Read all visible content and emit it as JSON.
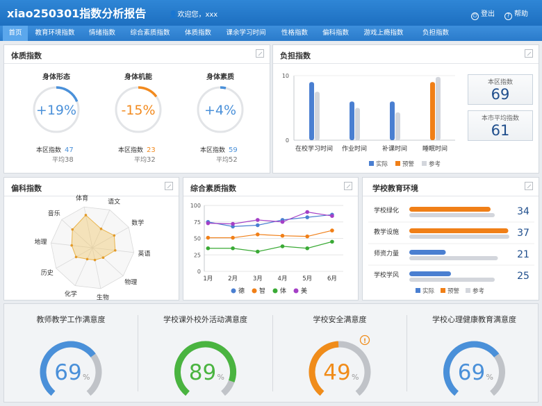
{
  "header": {
    "title": "xiao250301指数分析报告",
    "welcome": "欢迎您，xxx",
    "logout": "登出",
    "help": "帮助"
  },
  "nav": {
    "tabs": [
      "首页",
      "教育环境指数",
      "情绪指数",
      "综合素质指数",
      "体质指数",
      "课余学习时间",
      "性格指数",
      "偏科指数",
      "游戏上瘾指数",
      "负担指数"
    ]
  },
  "physique": {
    "title": "体质指数",
    "region_label": "本区指数",
    "avg_label": "平均",
    "items": [
      {
        "name": "身体形态",
        "value": "+19%",
        "region": "47",
        "avg": "38",
        "fraction": 0.19,
        "color": "#4a90d9"
      },
      {
        "name": "身体机能",
        "value": "-15%",
        "region": "23",
        "avg": "32",
        "fraction": 0.15,
        "color": "#f28a1e"
      },
      {
        "name": "身体素质",
        "value": "+4%",
        "region": "59",
        "avg": "52",
        "fraction": 0.04,
        "color": "#4a90d9"
      }
    ]
  },
  "burden": {
    "title": "负担指数",
    "chart_data": {
      "type": "bar",
      "categories": [
        "在校学习时间",
        "作业时间",
        "补课时间",
        "睡眠时间"
      ],
      "series": [
        {
          "name": "实际",
          "color": "#4a7fd1",
          "values": [
            9,
            6,
            6,
            9
          ]
        },
        {
          "name": "预警",
          "color": "#f07f17",
          "values": [
            0,
            0,
            0,
            0
          ]
        },
        {
          "name": "参考",
          "color": "#d3d6dc",
          "values": [
            7.5,
            5,
            4.3,
            9.8
          ]
        }
      ],
      "ylim": [
        0,
        10
      ],
      "yticks": [
        "0",
        "10"
      ]
    },
    "region_label": "本区指数",
    "region_value": "69",
    "city_label": "本市平均指数",
    "city_value": "61"
  },
  "partial": {
    "title": "偏科指数",
    "chart_data": {
      "type": "radar",
      "axes": [
        "体育",
        "语文",
        "数学",
        "英语",
        "物理",
        "生物",
        "化学",
        "历史",
        "地理",
        "音乐"
      ],
      "values": [
        0.8,
        0.5,
        0.6,
        0.55,
        0.35,
        0.3,
        0.3,
        0.45,
        0.5,
        0.65
      ],
      "max": 1
    }
  },
  "comprehensive": {
    "title": "综合素质指数",
    "chart_data": {
      "type": "line",
      "categories": [
        "1月",
        "2月",
        "3月",
        "4月",
        "5月",
        "6月"
      ],
      "ylim": [
        0,
        100
      ],
      "yticks": [
        "0",
        "25",
        "50",
        "75",
        "100"
      ],
      "series": [
        {
          "name": "德",
          "color": "#4a7fd1",
          "values": [
            75,
            68,
            70,
            78,
            82,
            86
          ]
        },
        {
          "name": "智",
          "color": "#f07f17",
          "values": [
            51,
            51,
            56,
            54,
            53,
            62
          ]
        },
        {
          "name": "体",
          "color": "#3aaa35",
          "values": [
            35,
            35,
            30,
            38,
            35,
            45
          ]
        },
        {
          "name": "美",
          "color": "#a43fc6",
          "values": [
            73,
            72,
            78,
            75,
            90,
            84
          ]
        }
      ]
    }
  },
  "school_env": {
    "title": "学校教育环境",
    "chart_data": {
      "type": "bar",
      "categories": [
        "学校绿化",
        "教学设施",
        "师资力量",
        "学校学风"
      ],
      "values": [
        "34",
        "37",
        "21",
        "25"
      ],
      "series": [
        {
          "name": "实际",
          "color": "#4a7fd1",
          "values": [
            0.55,
            0.6,
            0.35,
            0.4
          ]
        },
        {
          "name": "预警",
          "color": "#f07f17",
          "values": [
            0.78,
            0.95,
            0,
            0
          ]
        },
        {
          "name": "参考",
          "color": "#d3d6dc",
          "values": [
            0.82,
            0.96,
            0.85,
            0.82
          ]
        }
      ]
    }
  },
  "satisfaction": [
    {
      "title": "教师教学工作满意度",
      "value": "69",
      "unit": "%",
      "fraction": 0.69,
      "color": "#4a90d9"
    },
    {
      "title": "学校课外校外活动满意度",
      "value": "89",
      "unit": "%",
      "fraction": 0.89,
      "color": "#4ab440"
    },
    {
      "title": "学校安全满意度",
      "value": "49",
      "unit": "%",
      "fraction": 0.49,
      "color": "#f08c1a"
    },
    {
      "title": "学校心理健康教育满意度",
      "value": "69",
      "unit": "%",
      "fraction": 0.69,
      "color": "#4a90d9"
    }
  ]
}
